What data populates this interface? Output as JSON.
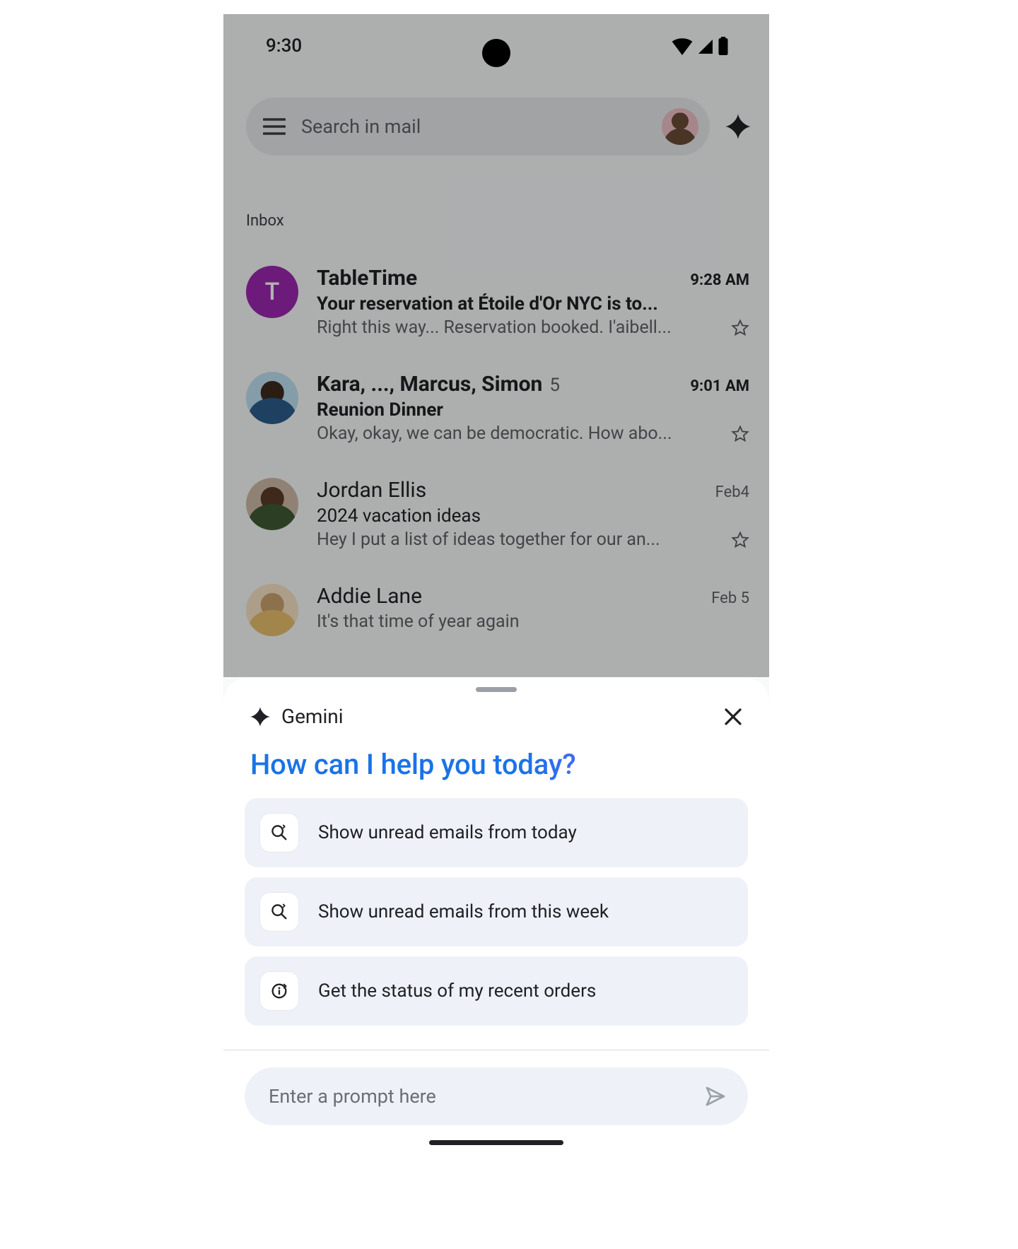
{
  "statusbar": {
    "time": "9:30"
  },
  "search": {
    "placeholder": "Search in mail"
  },
  "section_label": "Inbox",
  "emails": [
    {
      "avatar_letter": "T",
      "sender": "TableTime",
      "time": "9:28 AM",
      "subject": "Your reservation at Étoile d'Or NYC is to...",
      "snippet": "Right this way... Reservation booked. I'aibell...",
      "thread_count": ""
    },
    {
      "avatar_letter": "",
      "sender": "Kara, ..., Marcus, Simon",
      "time": "9:01 AM",
      "subject": "Reunion Dinner",
      "snippet": "Okay, okay, we can be democratic. How abo...",
      "thread_count": "5"
    },
    {
      "avatar_letter": "",
      "sender": "Jordan Ellis",
      "time": "Feb4",
      "subject": "2024 vacation ideas",
      "snippet": "Hey I put a list of ideas together for our an...",
      "thread_count": ""
    },
    {
      "avatar_letter": "",
      "sender": "Addie Lane",
      "time": "Feb 5",
      "subject": "",
      "snippet": "It's that time of year again",
      "thread_count": ""
    }
  ],
  "sheet": {
    "title": "Gemini",
    "greeting": "How can I help you today?",
    "suggestions": [
      "Show unread emails from today",
      "Show unread emails from this week",
      "Get the status of my recent orders"
    ],
    "prompt_placeholder": "Enter a prompt here"
  }
}
